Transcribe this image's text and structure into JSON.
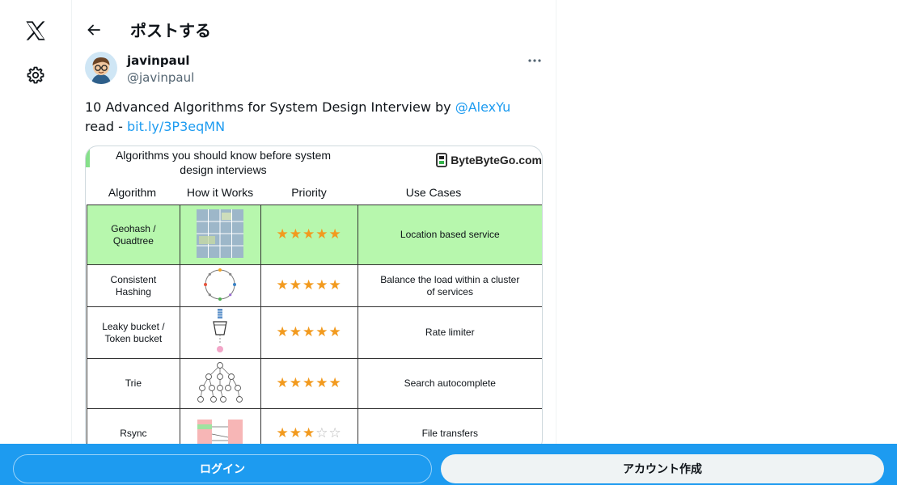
{
  "nav": {
    "logo_icon": "x-logo-icon",
    "settings_icon": "gear-icon"
  },
  "header": {
    "title": "ポストする"
  },
  "tweet": {
    "author": {
      "name": "javinpaul",
      "handle": "@javinpaul"
    },
    "text_part1": "10 Advanced Algorithms for System Design Interview  by ",
    "mention": "@AlexYu",
    "text_part2": "read  - ",
    "link": "bit.ly/3P3eqMN"
  },
  "media": {
    "title_line1": "Algorithms you should know before system",
    "title_line2": "design interviews",
    "brand": "ByteByteGo.com",
    "columns": [
      "Algorithm",
      "How it Works",
      "Priority",
      "Use Cases"
    ],
    "rows": [
      {
        "algorithm_l1": "Geohash /",
        "algorithm_l2": "Quadtree",
        "stars": 5,
        "use_l1": "Location based service",
        "use_l2": "",
        "highlight": "#b7f7ad"
      },
      {
        "algorithm_l1": "Consistent",
        "algorithm_l2": "Hashing",
        "stars": 5,
        "use_l1": "Balance the load within a cluster",
        "use_l2": "of services",
        "highlight": ""
      },
      {
        "algorithm_l1": "Leaky bucket /",
        "algorithm_l2": "Token bucket",
        "stars": 5,
        "use_l1": "Rate limiter",
        "use_l2": "",
        "highlight": ""
      },
      {
        "algorithm_l1": "Trie",
        "algorithm_l2": "",
        "stars": 5,
        "use_l1": "Search autocomplete",
        "use_l2": "",
        "highlight": ""
      },
      {
        "algorithm_l1": "Rsync",
        "algorithm_l2": "",
        "stars": 3,
        "use_l1": "File transfers",
        "use_l2": "",
        "highlight": ""
      }
    ]
  },
  "bottom": {
    "login": "ログイン",
    "signup": "アカウント作成"
  },
  "colors": {
    "accent": "#1d9bf0",
    "star": "#f29a1e",
    "highlight_row": "#b7f7ad"
  }
}
